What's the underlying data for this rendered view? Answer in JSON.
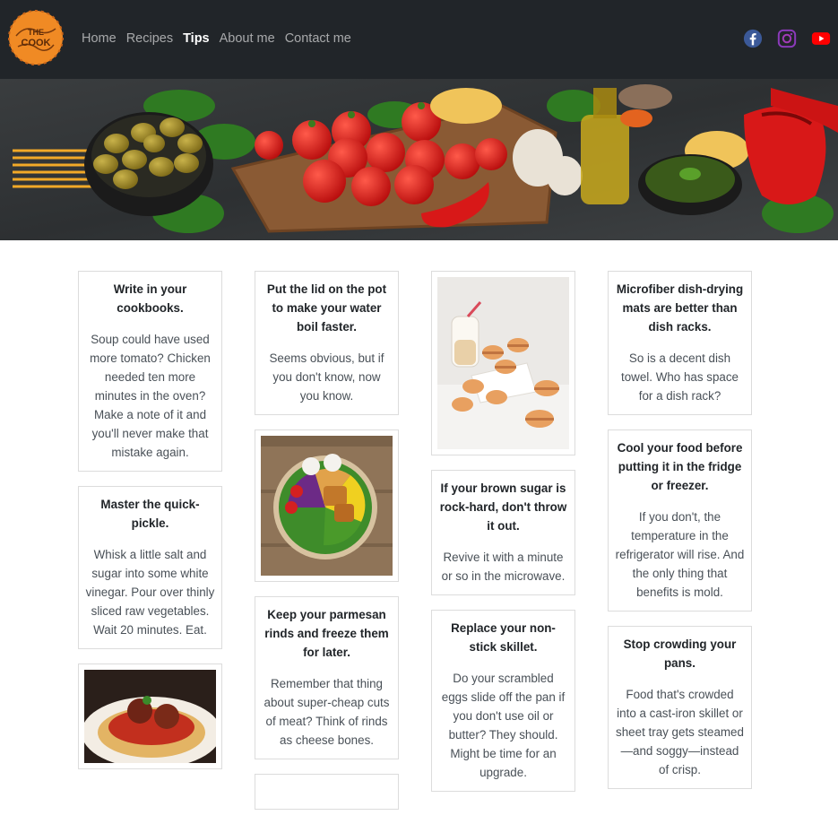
{
  "nav": {
    "logo_text": "THE COOK",
    "links": [
      "Home",
      "Recipes",
      "Tips",
      "About me",
      "Contact me"
    ],
    "active": "Tips",
    "socials": [
      "facebook-icon",
      "instagram-icon",
      "youtube-icon"
    ]
  },
  "colors": {
    "navbar_bg": "#212529",
    "logo_orange": "#f08a24",
    "facebook": "#3b5998",
    "instagram": "#8a3ab9",
    "youtube": "#ff0000"
  },
  "cards": {
    "c1": {
      "title": "Write in your cookbooks.",
      "text": "Soup could have used more tomato? Chicken needed ten more minutes in the oven? Make a note of it and you'll never make that mistake again."
    },
    "c2": {
      "title": "Master the quick-pickle.",
      "text": "Whisk a little salt and sugar into some white vinegar. Pour over thinly sliced raw vegetables. Wait 20 minutes. Eat."
    },
    "c3": {
      "title": "Put the lid on the pot to make your water boil faster.",
      "text": "Seems obvious, but if you don't know, now you know."
    },
    "c4": {
      "title": "Keep your parmesan rinds and freeze them for later.",
      "text": "Remember that thing about super-cheap cuts of meat? Think of rinds as cheese bones."
    },
    "c5": {
      "title": "If your brown sugar is rock-hard, don't throw it out.",
      "text": "Revive it with a minute or so in the microwave."
    },
    "c6": {
      "title": "Replace your non-stick skillet.",
      "text": "Do your scrambled eggs slide off the pan if you don't use oil or butter? They should. Might be time for an upgrade."
    },
    "c7": {
      "title": "Microfiber dish-drying mats are better than dish racks.",
      "text": "So is a decent dish towel. Who has space for a dish rack?"
    },
    "c8": {
      "title": "Cool your food before putting it in the fridge or freezer.",
      "text": "If you don't, the temperature in the refrigerator will rise. And the only thing that benefits is mold."
    },
    "c9": {
      "title": "Stop crowding your pans.",
      "text": "Food that's crowded into a cast-iron skillet or sheet tray gets steamed—and soggy—instead of crisp."
    }
  }
}
